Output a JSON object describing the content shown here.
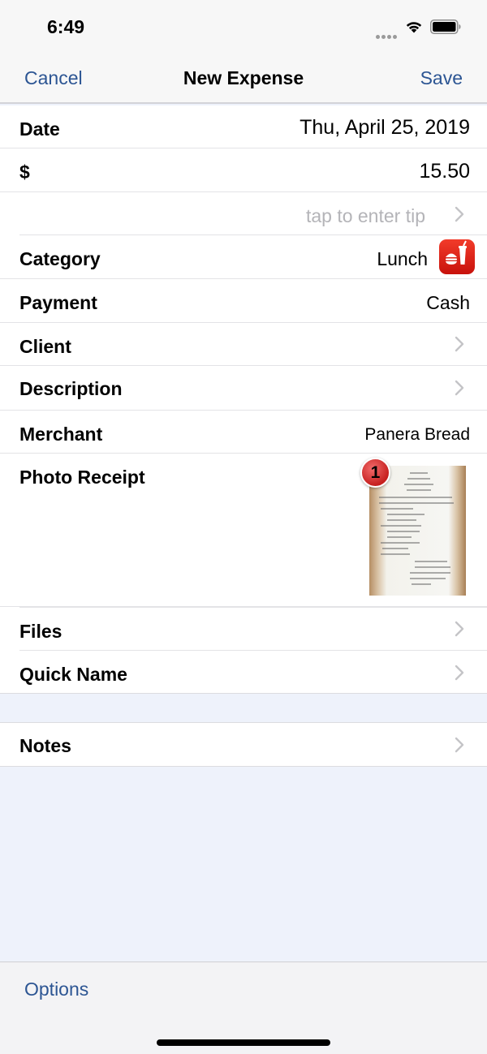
{
  "status_bar": {
    "time": "6:49"
  },
  "nav": {
    "cancel_label": "Cancel",
    "title": "New Expense",
    "save_label": "Save"
  },
  "form": {
    "date": {
      "label": "Date",
      "value": "Thu,  April 25, 2019"
    },
    "amount": {
      "label": "$",
      "value": "15.50"
    },
    "tip": {
      "placeholder": "tap to enter tip"
    },
    "category": {
      "label": "Category",
      "value": "Lunch",
      "icon": "fast-food-icon"
    },
    "payment": {
      "label": "Payment",
      "value": "Cash"
    },
    "client": {
      "label": "Client"
    },
    "description": {
      "label": "Description"
    },
    "merchant": {
      "label": "Merchant",
      "value": "Panera Bread"
    },
    "photo_receipt": {
      "label": "Photo Receipt",
      "badge_count": "1"
    },
    "files": {
      "label": "Files"
    },
    "quick_name": {
      "label": "Quick Name"
    }
  },
  "notes": {
    "label": "Notes"
  },
  "toolbar": {
    "options_label": "Options"
  },
  "colors": {
    "accent": "#2c5593",
    "background": "#eef2fb",
    "placeholder": "#b4b4b8",
    "category_icon": "#e0241a"
  }
}
